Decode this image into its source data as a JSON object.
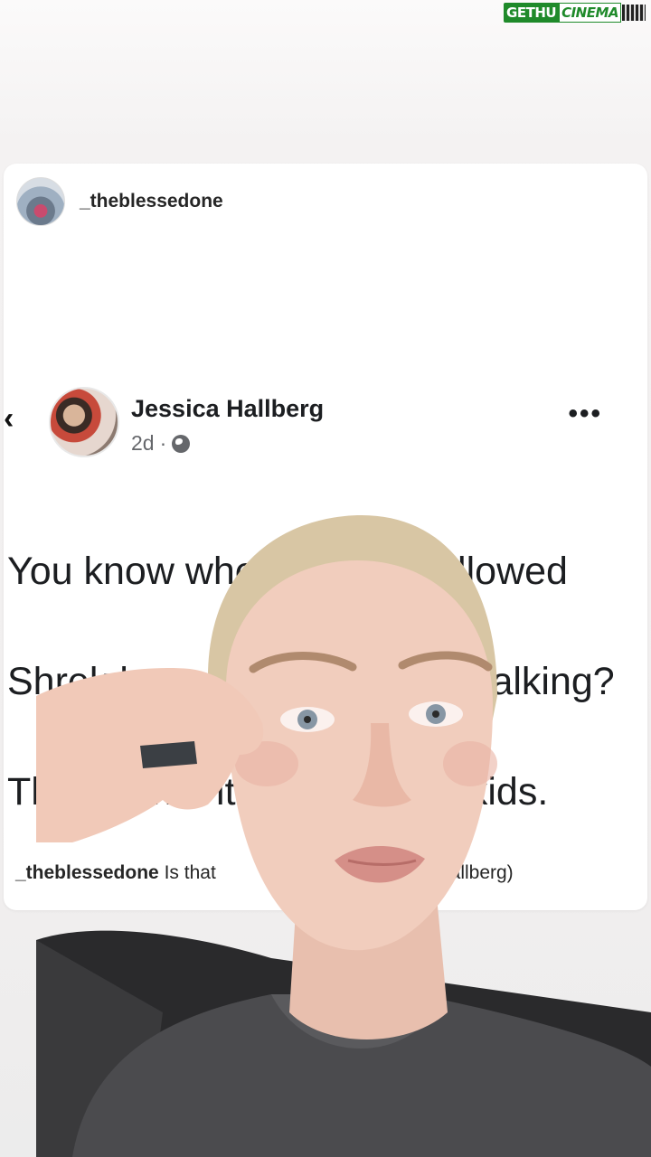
{
  "watermark": {
    "part1": "GETHU",
    "part2": "CINEMA"
  },
  "post": {
    "username": "_theblessedone",
    "avatar_icon": "profile-avatar-icon"
  },
  "shared_fb_post": {
    "author": "Jessica Hallberg",
    "time": "2d",
    "separator": "·",
    "privacy_icon": "globe-icon",
    "back_icon": "chevron-left-icon",
    "more_icon": "more-dots-icon",
    "text_lines": [
      "You know when donkey followed",
      "Shrek home and would not talking?",
      "That’s what it’s like raising kids."
    ]
  },
  "caption": {
    "username": "_theblessedone",
    "text_start": "Is that",
    "text_end": "Hallberg)"
  }
}
